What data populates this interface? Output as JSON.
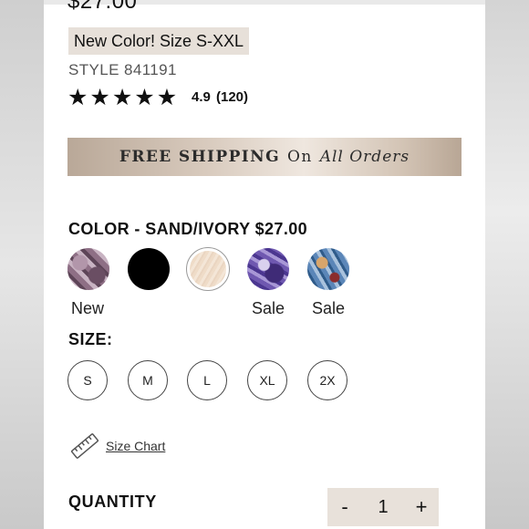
{
  "product": {
    "price": "$27.00",
    "badge": "New Color! Size S-XXL",
    "style": "STYLE 841191",
    "stars": [
      "★",
      "★",
      "★",
      "★",
      "★"
    ],
    "rating": "4.9",
    "reviews": "(120)"
  },
  "shipping": {
    "bold": "FREE SHIPPING",
    "on": "On",
    "italic": "All Orders"
  },
  "color": {
    "label": "COLOR - SAND/IVORY $27.00",
    "swatch_labels": [
      "New",
      "",
      "",
      "Sale",
      "Sale"
    ]
  },
  "size": {
    "label": "SIZE:",
    "options": [
      "S",
      "M",
      "L",
      "XL",
      "2X"
    ]
  },
  "size_chart": {
    "label": "Size Chart"
  },
  "quantity": {
    "label": "QUANTITY",
    "minus": "-",
    "value": "1",
    "plus": "+"
  }
}
